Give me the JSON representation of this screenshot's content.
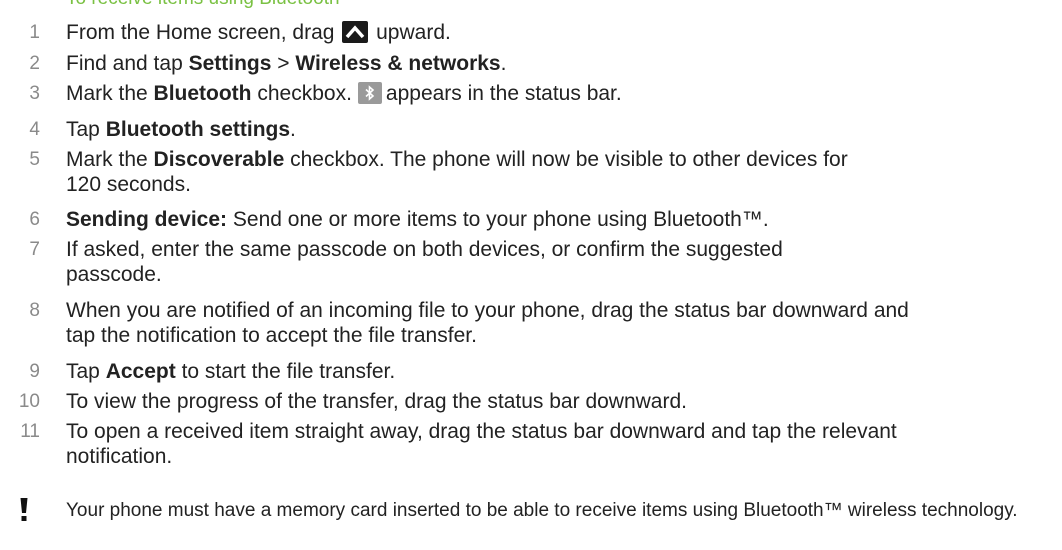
{
  "section": {
    "heading": "To receive items using Bluetooth™"
  },
  "steps": [
    {
      "num": "1",
      "parts": [
        "From the Home screen, drag",
        "upward."
      ]
    },
    {
      "num": "2",
      "pre": "Find and tap ",
      "b1": "Settings",
      "mid": " > ",
      "b2": "Wireless & networks",
      "post": "."
    },
    {
      "num": "3",
      "pre": "Mark the ",
      "b1": "Bluetooth",
      "mid": " checkbox.",
      "post": "appears in the status bar."
    },
    {
      "num": "4",
      "pre": "Tap ",
      "b1": "Bluetooth settings",
      "post": "."
    },
    {
      "num": "5",
      "pre": "Mark the ",
      "b1": "Discoverable",
      "post": " checkbox. The phone will now be visible to other devices for 120 seconds."
    },
    {
      "num": "6",
      "b1": "Sending device:",
      "post": " Send one or more items to your phone using Bluetooth™."
    },
    {
      "num": "7",
      "text": "If asked, enter the same passcode on both devices, or confirm the suggested passcode."
    },
    {
      "num": "8",
      "text": "When you are notified of an incoming file to your phone, drag the status bar downward and tap the notification to accept the file transfer."
    },
    {
      "num": "9",
      "pre": "Tap ",
      "b1": "Accept",
      "post": " to start the file transfer."
    },
    {
      "num": "10",
      "text": "To view the progress of the transfer, drag the status bar downward."
    },
    {
      "num": "11",
      "text": "To open a received item straight away, drag the status bar downward and tap the relevant notification."
    }
  ],
  "note": {
    "icon": "exclamation-icon",
    "text": "Your phone must have a memory card inserted to be able to receive items using Bluetooth™ wireless technology."
  },
  "icons": {
    "step1": "up-arrow-icon",
    "step3": "bluetooth-icon"
  },
  "colors": {
    "heading": "#7ac143",
    "step_number": "#8a8a8a",
    "text": "#222222"
  }
}
